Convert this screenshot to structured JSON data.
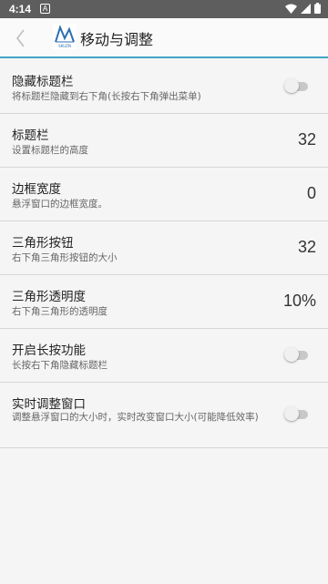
{
  "status_bar": {
    "time": "4:14",
    "notif_glyph": "A"
  },
  "header": {
    "title": "移动与调整",
    "logo_text": "SKUZN"
  },
  "colors": {
    "accent": "#42a5c5"
  },
  "settings": [
    {
      "title": "隐藏标题栏",
      "subtitle": "将标题栏隐藏到右下角(长按右下角弹出菜单)",
      "type": "toggle",
      "on": false
    },
    {
      "title": "标题栏",
      "subtitle": "设置标题栏的高度",
      "type": "value",
      "value": "32"
    },
    {
      "title": "边框宽度",
      "subtitle": "悬浮窗口的边框宽度。",
      "type": "value",
      "value": "0"
    },
    {
      "title": "三角形按钮",
      "subtitle": "右下角三角形按钮的大小",
      "type": "value",
      "value": "32"
    },
    {
      "title": "三角形透明度",
      "subtitle": "右下角三角形的透明度",
      "type": "value",
      "value": "10%"
    },
    {
      "title": "开启长按功能",
      "subtitle": "长按右下角隐藏标题栏",
      "type": "toggle",
      "on": false
    },
    {
      "title": "实时调整窗口",
      "subtitle": "调整悬浮窗口的大小时，实时改变窗口大小(可能降低效率)",
      "type": "toggle",
      "on": false
    }
  ]
}
